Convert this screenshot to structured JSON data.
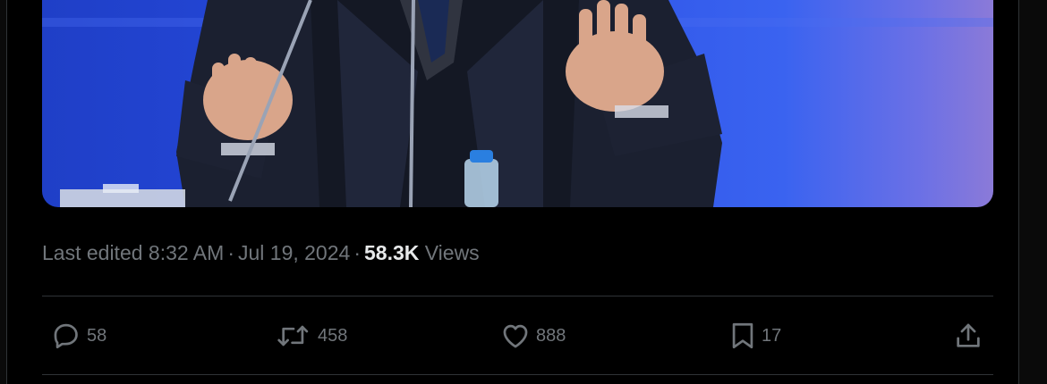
{
  "media": {
    "image_icon": "photo-of-speaker-at-podium"
  },
  "tweet_meta": {
    "edited_prefix": "Last edited",
    "time": "8:32 AM",
    "separator": "·",
    "date": "Jul 19, 2024",
    "views_count": "58.3K",
    "views_label": "Views"
  },
  "actions": {
    "reply": {
      "icon": "reply-icon",
      "count": "58"
    },
    "repost": {
      "icon": "repost-icon",
      "count": "458"
    },
    "like": {
      "icon": "heart-icon",
      "count": "888"
    },
    "bookmark": {
      "icon": "bookmark-icon",
      "count": "17"
    },
    "share": {
      "icon": "share-icon"
    }
  },
  "colors": {
    "background": "#000000",
    "text_secondary": "#71767b",
    "text_primary": "#e7e9ea",
    "divider": "#2f3336",
    "media_blue": "#2f55e8"
  }
}
